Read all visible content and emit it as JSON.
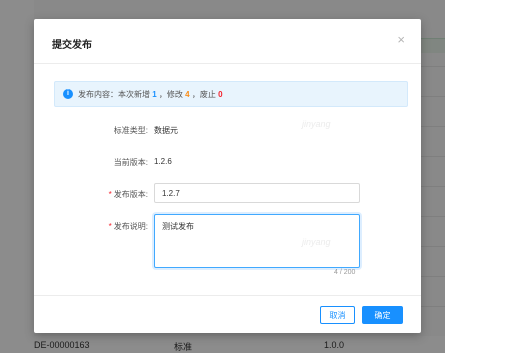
{
  "background": {
    "bottom_row": {
      "code": "DE-00000163",
      "type": "标准",
      "version": "1.0.0"
    },
    "watermark": "jinyang"
  },
  "modal": {
    "title": "提交发布",
    "close_icon": "close-icon",
    "alert": {
      "icon": "info-icon",
      "prefix": "发布内容：本次新增",
      "added": "1",
      "sep1": "，修改",
      "modified": "4",
      "sep2": "，废止",
      "abolished": "0"
    },
    "fields": {
      "standard_type_label": "标准类型:",
      "standard_type_value": "数据元",
      "current_version_label": "当前版本:",
      "current_version_value": "1.2.6",
      "release_version_label": "发布版本:",
      "release_version_value": "1.2.7",
      "release_note_label": "发布说明:",
      "release_note_value": "测试发布",
      "required_mark": "*",
      "counter": "4 / 200"
    },
    "buttons": {
      "cancel": "取消",
      "ok": "确定"
    }
  },
  "colors": {
    "primary": "#1890ff",
    "orange": "#fa8c16",
    "red": "#f5222d",
    "alert_bg": "#e8f4fd"
  }
}
